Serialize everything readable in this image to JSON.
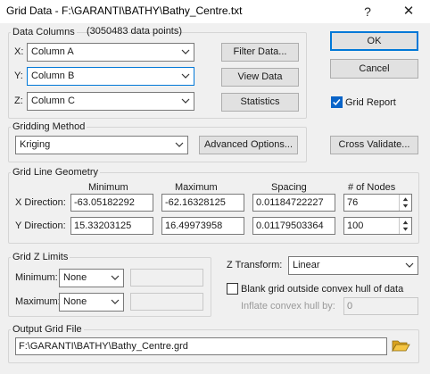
{
  "window": {
    "title": "Grid Data - F:\\GARANTI\\BATHY\\Bathy_Centre.txt",
    "help": "?",
    "close": "✕"
  },
  "data_columns": {
    "legend": "Data Columns",
    "count": "(3050483 data points)",
    "x": {
      "label": "X:",
      "value": "Column A"
    },
    "y": {
      "label": "Y:",
      "value": "Column B"
    },
    "z": {
      "label": "Z:",
      "value": "Column C"
    },
    "filter_btn": "Filter Data...",
    "view_btn": "View Data",
    "stats_btn": "Statistics"
  },
  "buttons": {
    "ok": "OK",
    "cancel": "Cancel",
    "cross_validate": "Cross Validate..."
  },
  "grid_report": {
    "label": "Grid Report",
    "checked": true
  },
  "gridding": {
    "legend": "Gridding Method",
    "method": "Kriging",
    "advanced_btn": "Advanced Options..."
  },
  "geometry": {
    "legend": "Grid Line Geometry",
    "headers": {
      "min": "Minimum",
      "max": "Maximum",
      "spacing": "Spacing",
      "nodes": "# of Nodes"
    },
    "x": {
      "label": "X Direction:",
      "min": "-63.05182292",
      "max": "-62.16328125",
      "spacing": "0.01184722227",
      "nodes": "76"
    },
    "y": {
      "label": "Y Direction:",
      "min": "15.33203125",
      "max": "16.49973958",
      "spacing": "0.01179503364",
      "nodes": "100"
    }
  },
  "z_limits": {
    "legend": "Grid Z Limits",
    "min": {
      "label": "Minimum:",
      "value": "None"
    },
    "max": {
      "label": "Maximum:",
      "value": "None"
    }
  },
  "z_transform": {
    "label": "Z Transform:",
    "value": "Linear"
  },
  "blank_hull": {
    "label": "Blank grid outside convex hull of data",
    "checked": false
  },
  "inflate": {
    "label": "Inflate convex hull by:",
    "value": "0"
  },
  "output": {
    "legend": "Output Grid File",
    "path": "F:\\GARANTI\\BATHY\\Bathy_Centre.grd"
  }
}
